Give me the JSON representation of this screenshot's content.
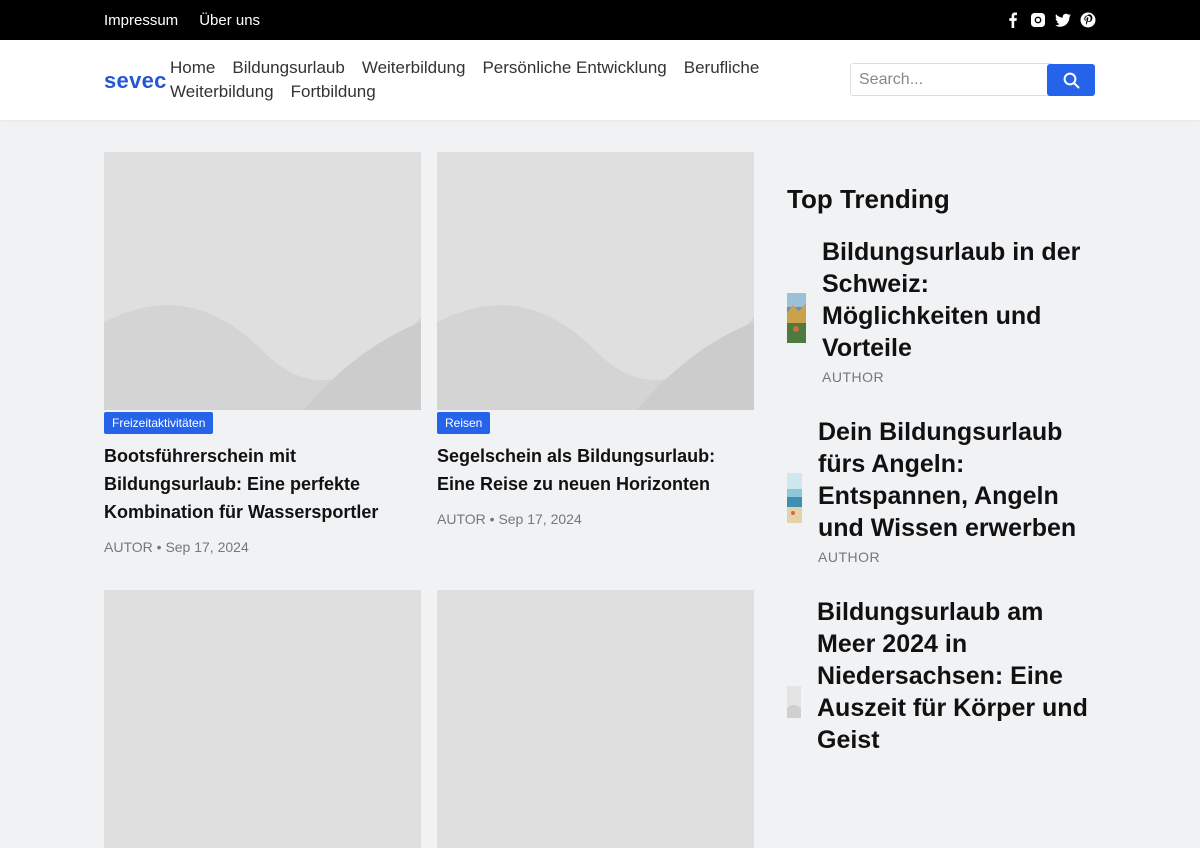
{
  "topbar": {
    "links": [
      "Impressum",
      "Über uns"
    ],
    "social_icons": [
      "facebook-icon",
      "instagram-icon",
      "twitter-icon",
      "pinterest-icon"
    ]
  },
  "header": {
    "logo": "sevec",
    "nav": [
      "Home",
      "Bildungsurlaub",
      "Weiterbildung",
      "Persönliche Entwicklung",
      "Berufliche Weiterbildung",
      "Fortbildung"
    ],
    "search_placeholder": "Search..."
  },
  "posts": [
    {
      "category": "Freizeitaktivitäten",
      "title": "Bootsführerschein mit Bildungsurlaub: Eine perfekte Kombination für Wassersportler",
      "author": "AUTOR",
      "date": "Sep 17, 2024"
    },
    {
      "category": "Reisen",
      "title": "Segelschein als Bildungsurlaub: Eine Reise zu neuen Horizonten",
      "author": "AUTOR",
      "date": "Sep 17, 2024"
    },
    {
      "category": "",
      "title": "",
      "author": "",
      "date": ""
    },
    {
      "category": "",
      "title": "",
      "author": "",
      "date": ""
    }
  ],
  "sidebar": {
    "title": "Top Trending",
    "items": [
      {
        "title": "Bildungsurlaub in der Schweiz: Möglichkeiten und Vorteile",
        "author": "AUTHOR"
      },
      {
        "title": "Dein Bildungsurlaub fürs Angeln: Entspannen, Angeln und Wissen erwerben",
        "author": "AUTHOR"
      },
      {
        "title": "Bildungsurlaub am Meer 2024 in Niedersachsen: Eine Auszeit für Körper und Geist",
        "author": ""
      }
    ]
  },
  "colors": {
    "accent": "#2563eb",
    "topbar": "#000000",
    "background": "#f1f2f4"
  }
}
